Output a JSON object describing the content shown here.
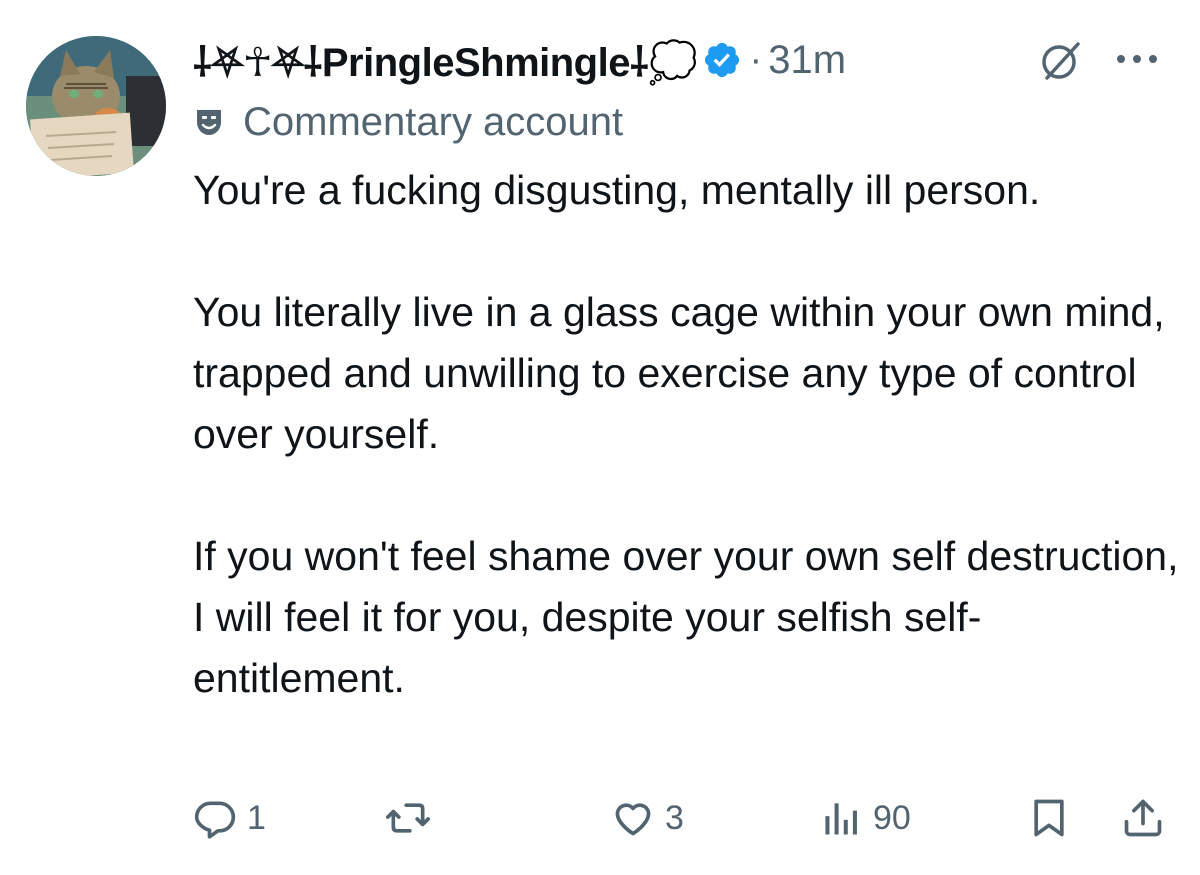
{
  "post": {
    "display_name": "⸸⛧☥⛧⸸PringleShmingle⸸💭",
    "timestamp": "31m",
    "separator": "·",
    "account_label": "Commentary account",
    "body_paragraphs": [
      "You're a fucking disgusting, mentally ill person.",
      "You literally live in a glass cage within your own mind, trapped and unwilling to exercise any type of control over yourself.",
      "If you won't feel shame over your own self destruction, I will feel it for you, despite your selfish self-entitlement."
    ]
  },
  "actions": {
    "replies": "1",
    "reposts": "",
    "likes": "3",
    "views": "90"
  },
  "icons": {
    "verified": "verified-badge-icon",
    "grok": "grok-icon",
    "more": "more-dots-icon",
    "label": "theater-mask-icon",
    "reply": "reply-icon",
    "repost": "repost-icon",
    "like": "heart-icon",
    "views": "views-chart-icon",
    "bookmark": "bookmark-icon",
    "share": "share-icon"
  },
  "colors": {
    "text_primary": "#0f1419",
    "text_secondary": "#536471",
    "verified_blue": "#1d9bf0"
  }
}
